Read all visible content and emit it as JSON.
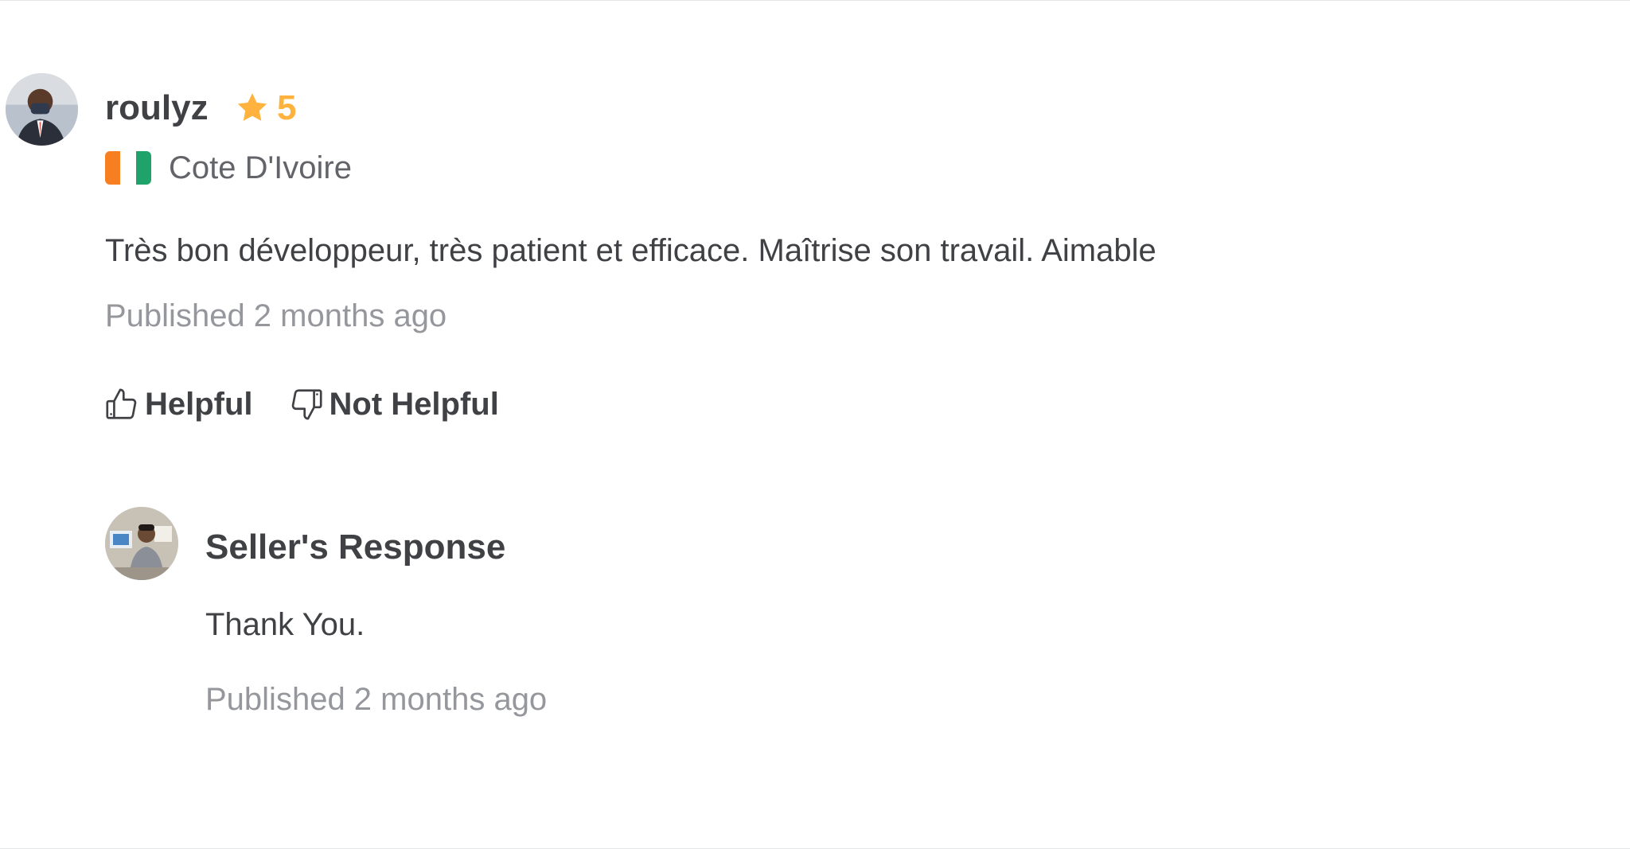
{
  "review": {
    "reviewer_name": "roulyz",
    "rating": "5",
    "country": "Cote D'Ivoire",
    "flag_colors": [
      "#f77f22",
      "#ffffff",
      "#1fa36b"
    ],
    "text": "Très bon développeur, très patient et efficace. Maîtrise son travail. Aimable",
    "published": "Published 2 months ago",
    "helpful_label": "Helpful",
    "not_helpful_label": "Not Helpful"
  },
  "seller_response": {
    "title": "Seller's Response",
    "text": "Thank You.",
    "published": "Published 2 months ago"
  },
  "colors": {
    "star": "#ffb33e",
    "text_dark": "#404145",
    "text_muted": "#95979d"
  },
  "icons": {
    "rating": "star-icon",
    "helpful": "thumbs-up-icon",
    "not_helpful": "thumbs-down-icon"
  }
}
